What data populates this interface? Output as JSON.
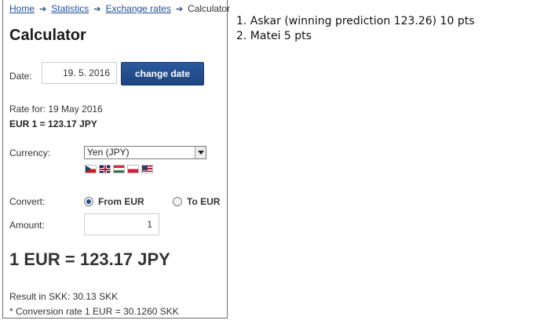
{
  "breadcrumb": {
    "home": "Home",
    "statistics": "Statistics",
    "exchange_rates": "Exchange rates",
    "current": "Calculator",
    "separator": "➔"
  },
  "calculator": {
    "title": "Calculator",
    "date_label": "Date:",
    "date_value": "19. 5. 2016",
    "change_date_button": "change date",
    "rate_for": "Rate for: 19 May 2016",
    "rate_value": "EUR 1 = 123.17 JPY",
    "currency_label": "Currency:",
    "currency_selected": "Yen (JPY)",
    "flags": [
      "flag-cz",
      "flag-gb",
      "flag-hu",
      "flag-pl",
      "flag-us"
    ],
    "convert_label": "Convert:",
    "from_eur_label": "From EUR",
    "to_eur_label": "To EUR",
    "convert_selected": "From EUR",
    "amount_label": "Amount:",
    "amount_value": "1",
    "result": "1 EUR = 123.17 JPY",
    "result_skk": "Result in SKK: 30.13 SKK",
    "conversion_rate": "* Conversion rate 1 EUR = 30.1260 SKK"
  },
  "ranking": {
    "items": [
      "1. Askar (winning prediction 123.26) 10 pts",
      "2. Matei 5 pts"
    ]
  },
  "colors": {
    "accent": "#1f4f9a",
    "button": "#2b5a9e",
    "text": "#333333"
  }
}
